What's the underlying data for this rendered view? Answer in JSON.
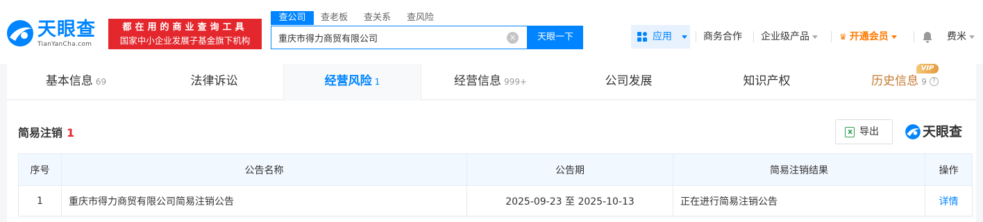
{
  "header": {
    "logo_text": "天眼查",
    "logo_domain": "TianYanCha.com",
    "slogan_line1": "都在用的商业查询工具",
    "slogan_line2": "国家中小企业发展子基金旗下机构",
    "search_tabs": [
      "查公司",
      "查老板",
      "查关系",
      "查风险"
    ],
    "search_value": "重庆市得力商贸有限公司",
    "search_button": "天眼一下",
    "nav": {
      "app": "应用",
      "business": "商务合作",
      "enterprise": "企业级产品",
      "vip": "开通会员",
      "user": "费米"
    }
  },
  "tabs": [
    {
      "label": "基本信息",
      "count": "69"
    },
    {
      "label": "法律诉讼",
      "count": ""
    },
    {
      "label": "经营风险",
      "count": "1"
    },
    {
      "label": "经营信息",
      "count": "999+"
    },
    {
      "label": "公司发展",
      "count": ""
    },
    {
      "label": "知识产权",
      "count": ""
    },
    {
      "label": "历史信息",
      "count": "9"
    }
  ],
  "vip_tag": "VIP",
  "section": {
    "title": "简易注销",
    "count": "1",
    "export_label": "导出",
    "watermark": "天眼查"
  },
  "table": {
    "headers": [
      "序号",
      "公告名称",
      "公告期",
      "简易注销结果",
      "操作"
    ],
    "rows": [
      {
        "index": "1",
        "name": "重庆市得力商贸有限公司简易注销公告",
        "period": "2025-09-23 至 2025-10-13",
        "result": "正在进行简易注销公告",
        "action": "详情"
      }
    ]
  },
  "colors": {
    "brand_blue": "#0084ff",
    "slogan_red": "#e3272d",
    "vip_orange": "#ff7a00"
  }
}
